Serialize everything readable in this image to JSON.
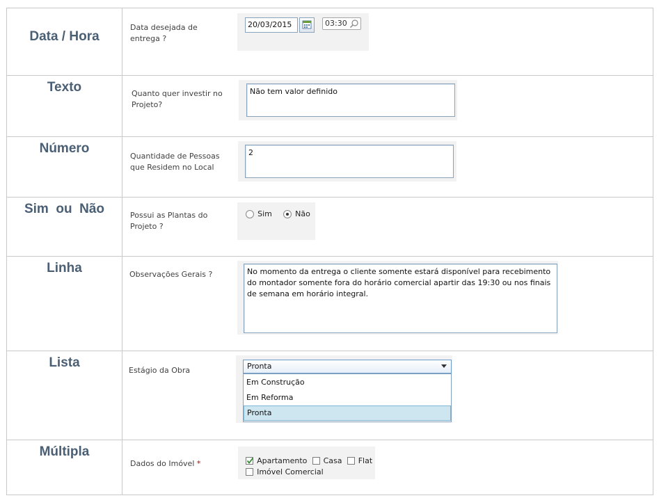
{
  "rows": {
    "datetime": {
      "category": "Data / Hora",
      "label": "Data desejada de entrega ?",
      "date_value": "20/03/2015",
      "time_value": "03:30",
      "calendar_icon": "calendar-icon",
      "time_icon": "search-icon"
    },
    "text": {
      "category": "Texto",
      "label": "Quanto quer investir no Projeto?",
      "value": "Não tem valor definido"
    },
    "number": {
      "category": "Número",
      "label": "Quantidade de Pessoas que Residem no Local",
      "value": "2"
    },
    "yesno": {
      "category": "Sim  ou  Não",
      "label": "Possui as Plantas do Projeto ?",
      "options": [
        "Sim",
        "Não"
      ],
      "selected": "Não"
    },
    "line": {
      "category": "Linha",
      "label": "Observações Gerais ?",
      "value": "No momento da entrega o cliente somente estará disponível para recebimento do montador somente fora do horário comercial apartir das 19:30 ou nos finais de semana em horário integral."
    },
    "list": {
      "category": "Lista",
      "label": "Estágio da Obra",
      "selected": "Pronta",
      "options": [
        "Em Construção",
        "Em Reforma",
        "Pronta"
      ]
    },
    "multiple": {
      "category": "Múltipla",
      "label": "Dados do Imóvel",
      "required_mark": "*",
      "options": [
        {
          "label": "Apartamento",
          "checked": true
        },
        {
          "label": "Casa",
          "checked": false
        },
        {
          "label": "Flat",
          "checked": false
        },
        {
          "label": "Imóvel Comercial",
          "checked": false
        }
      ]
    }
  },
  "colors": {
    "category_text": "#4a5e74",
    "border": "#c8c8c8",
    "panel": "#f2f2f2",
    "input_border": "#8aa3bd",
    "highlight": "#cde6f0",
    "required": "#cc0000",
    "check": "#2e8b2e"
  }
}
